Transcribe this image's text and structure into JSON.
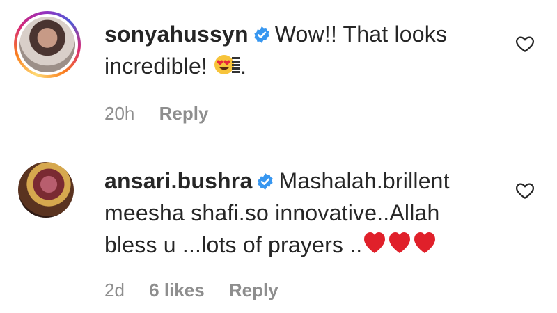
{
  "comments": [
    {
      "username": "sonyahussyn",
      "verified": true,
      "text_line1": "Wow!! That looks",
      "text_line2": "incredible!",
      "text_tail": ".",
      "emoji": "heart-eyes-emoji",
      "time": "20h",
      "reply_label": "Reply"
    },
    {
      "username": "ansari.bushra",
      "verified": true,
      "text_line1": "Mashalah.brillent",
      "text_line2": "meesha shafi.so innovative..Allah",
      "text_line3": "bless u ...lots of prayers ..",
      "emoji": "red-heart-emoji",
      "time": "2d",
      "likes": "6 likes",
      "reply_label": "Reply"
    }
  ],
  "colors": {
    "text": "#262626",
    "muted": "#8e8e8e",
    "verified": "#3897f0",
    "heart": "#e0202a"
  }
}
